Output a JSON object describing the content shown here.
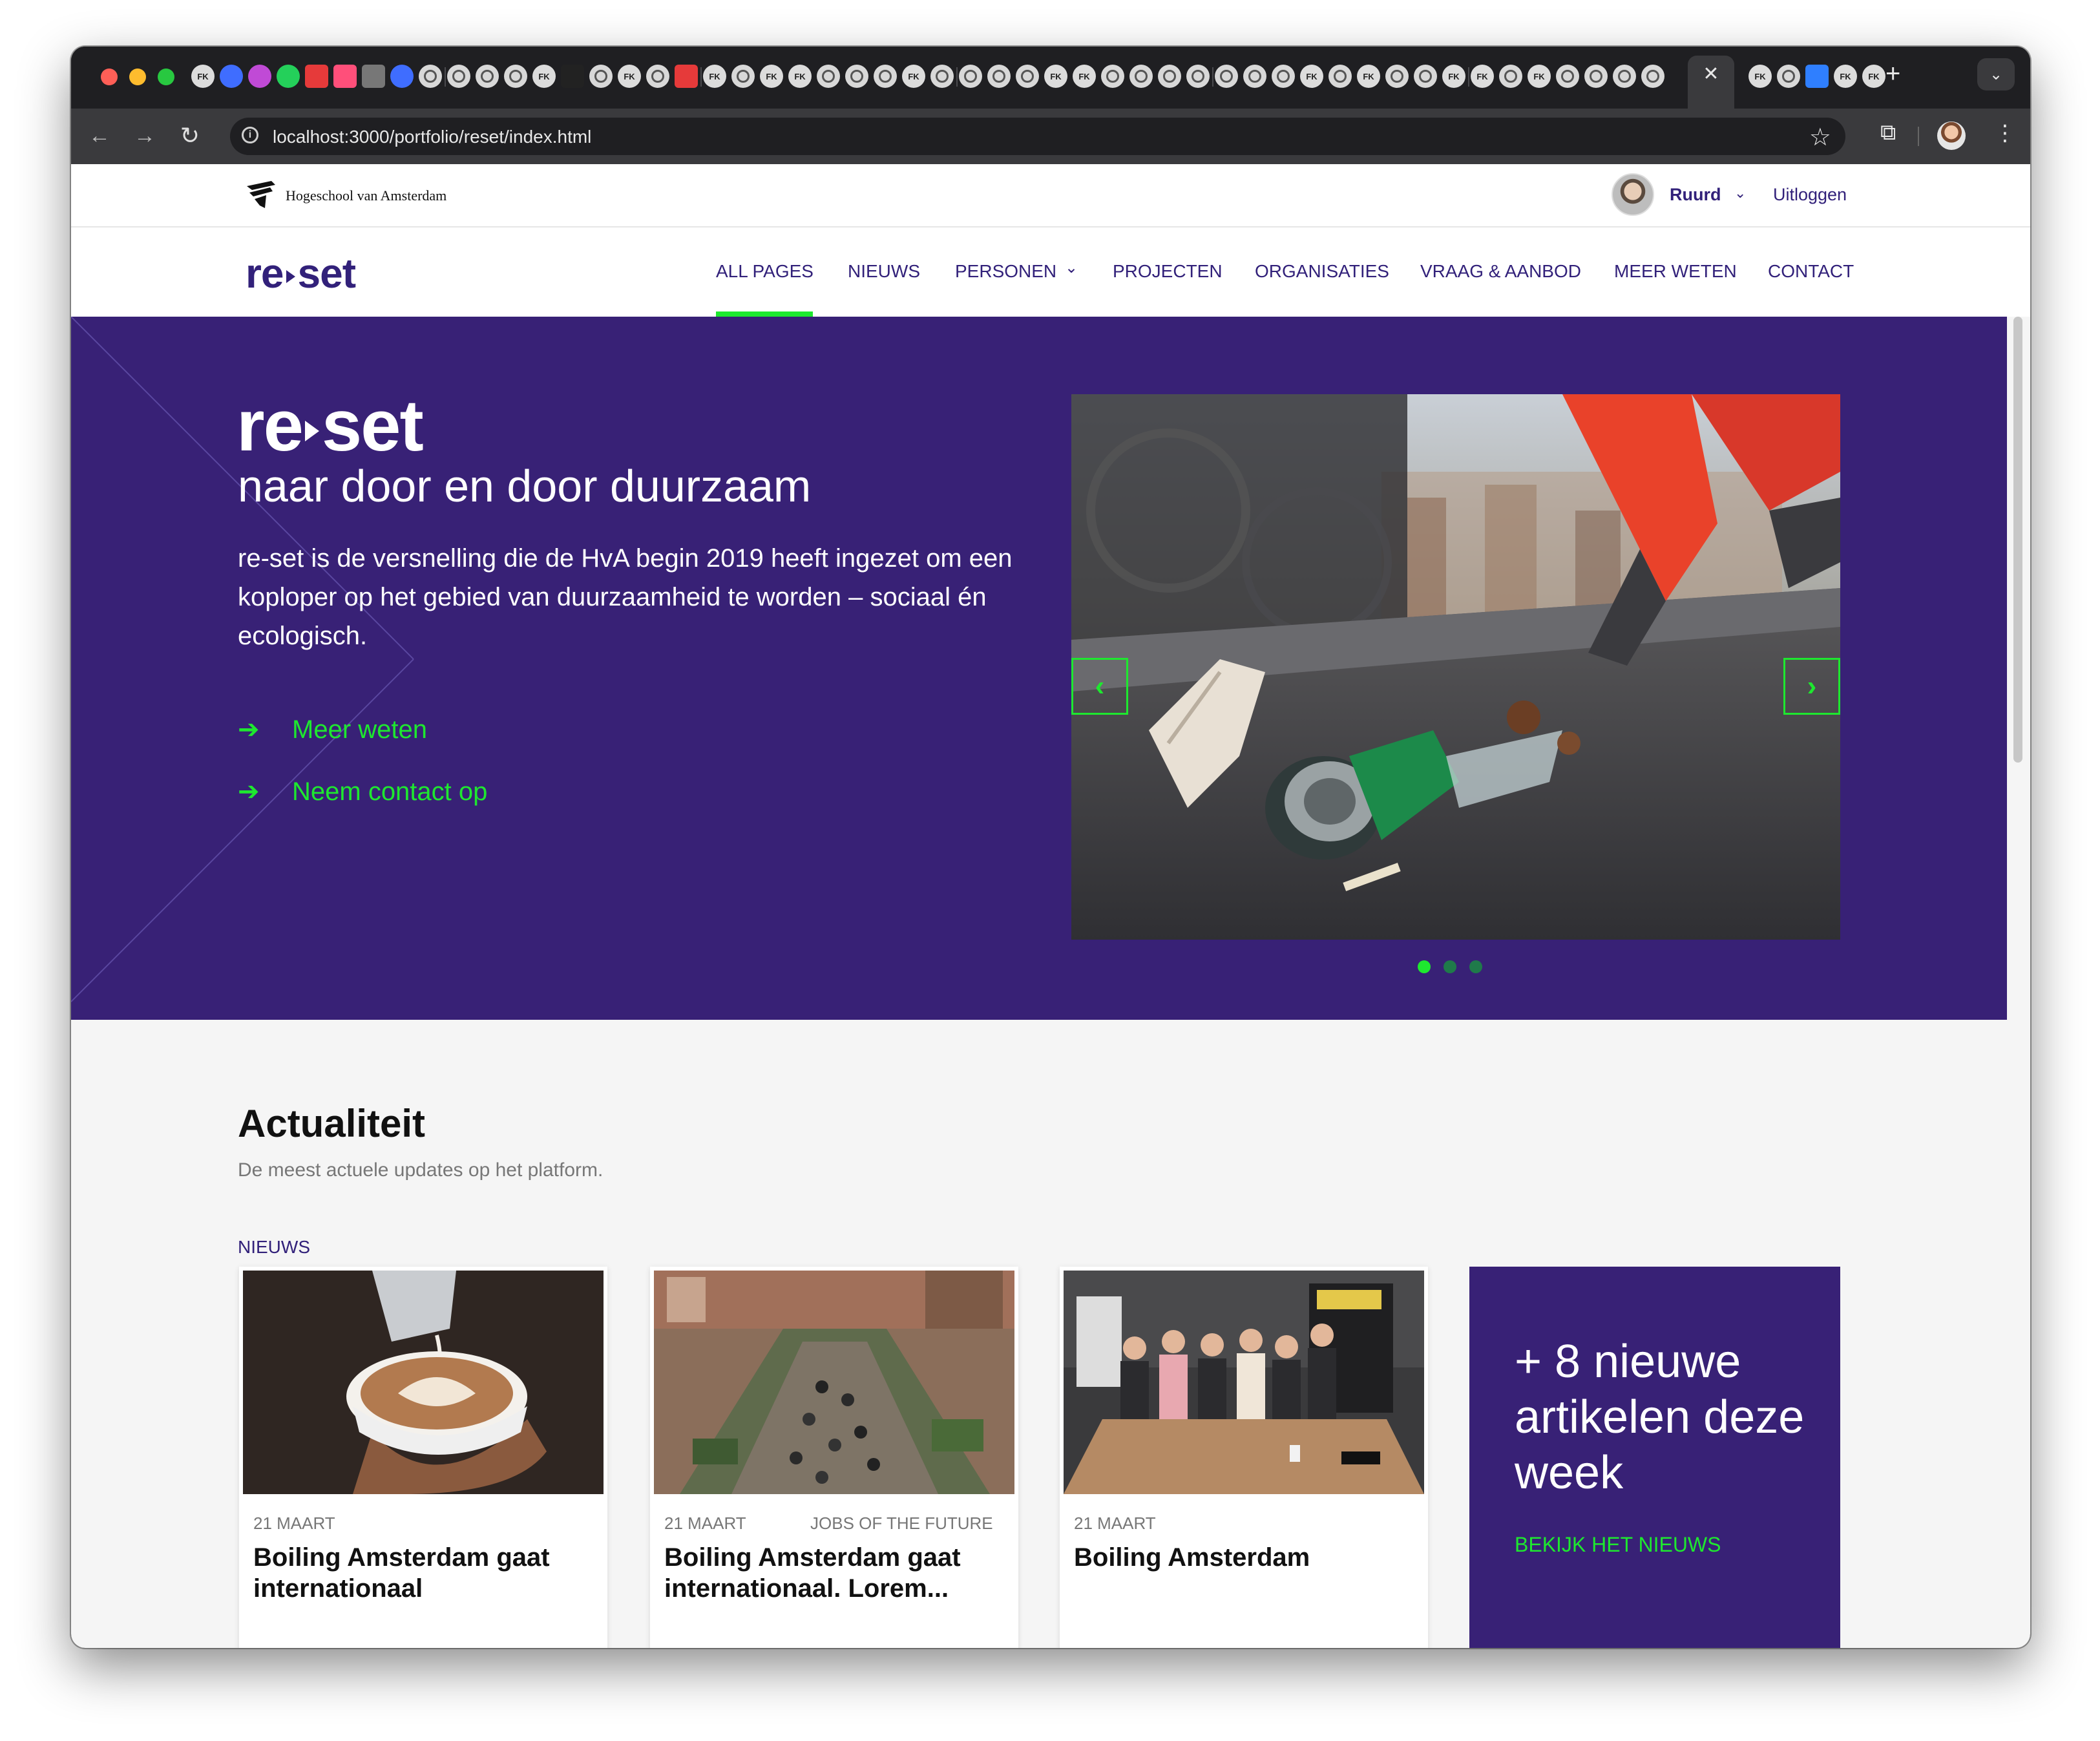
{
  "browser": {
    "tab_icon_labels": [
      "FK",
      "FK",
      "FK",
      "FK",
      "FK",
      "FK",
      "FK",
      "FK",
      "FK",
      "FK",
      "FK",
      "FK",
      "FK",
      "FK"
    ],
    "url": "localhost:3000/portfolio/reset/index.html"
  },
  "site": {
    "institution": "Hogeschool van Amsterdam",
    "user_name": "Ruurd",
    "logout_label": "Uitloggen",
    "brand_left": "re",
    "brand_right": "set",
    "nav": {
      "all_pages": "ALL PAGES",
      "nieuws": "NIEUWS",
      "personen": "PERSONEN",
      "projecten": "PROJECTEN",
      "organisaties": "ORGANISATIES",
      "vraag_aanbod": "VRAAG & AANBOD",
      "meer_weten": "MEER WETEN",
      "contact": "CONTACT"
    },
    "nav_active": "ALL PAGES"
  },
  "hero": {
    "brand_left": "re",
    "brand_right": "set",
    "subtitle": "naar door en door duurzaam",
    "body": "re-set is de versnelling die de HvA begin 2019 heeft ingezet om een koploper op het gebied van duurzaamheid te worden – sociaal én ecologisch.",
    "link_more": "Meer weten",
    "link_contact": "Neem contact op",
    "slide_count": 3,
    "active_slide": 1
  },
  "actualiteit": {
    "title": "Actualiteit",
    "subtitle": "De meest actuele updates op het platform.",
    "tag": "NIEUWS",
    "cards": [
      {
        "date": "21 MAART",
        "category": "",
        "title": "Boiling Amsterdam gaat internationaal"
      },
      {
        "date": "21 MAART",
        "category": "JOBS OF THE FUTURE",
        "title": "Boiling Amsterdam gaat internationaal. Lorem..."
      },
      {
        "date": "21 MAART",
        "category": "",
        "title": "Boiling Amsterdam"
      }
    ],
    "promo": {
      "text": "+ 8 nieuwe artikelen deze week",
      "link": "BEKIJK HET NIEUWS"
    }
  },
  "colors": {
    "brand_purple": "#382176",
    "accent_green": "#1ee82f",
    "nav_text": "#32217a"
  },
  "icons": {
    "back": "arrow-left-icon",
    "forward": "arrow-right-icon",
    "reload": "reload-icon",
    "bookmark": "star-icon",
    "extensions": "puzzle-icon",
    "menu": "kebab-icon",
    "link_arrow": "arrow-right-icon",
    "slider_prev": "chevron-left-icon",
    "slider_next": "chevron-right-icon"
  }
}
